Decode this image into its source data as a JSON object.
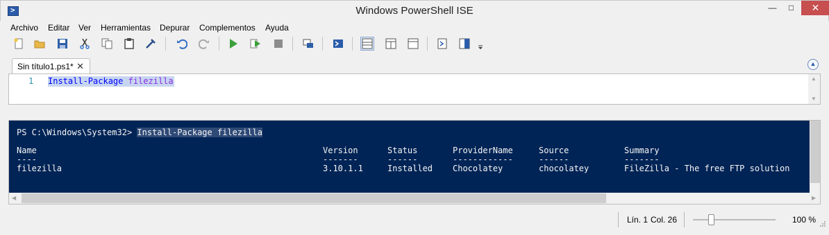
{
  "window": {
    "title": "Windows PowerShell ISE",
    "minimize": "—",
    "maximize": "□",
    "close": "✕"
  },
  "menu": [
    "Archivo",
    "Editar",
    "Ver",
    "Herramientas",
    "Depurar",
    "Complementos",
    "Ayuda"
  ],
  "toolbar": {
    "icons": [
      "new-file-icon",
      "open-folder-icon",
      "save-icon",
      "cut-icon",
      "copy-icon",
      "paste-icon",
      "clear-console-icon",
      "undo-icon",
      "redo-icon",
      "run-script-icon",
      "run-selection-icon",
      "stop-icon",
      "new-remote-tab-icon",
      "start-powershell-icon",
      "show-script-top-icon",
      "show-script-right-icon",
      "show-script-max-icon",
      "show-command-window-icon",
      "show-command-addon-icon",
      "toolbar-overflow-icon"
    ]
  },
  "tabs": [
    {
      "label": "Sin título1.ps1*",
      "close": "✕"
    }
  ],
  "editor": {
    "line_number": "1",
    "command": "Install-Package",
    "argument": "filezilla"
  },
  "console": {
    "prompt": "PS C:\\Windows\\System32> ",
    "command": "Install-Package filezilla",
    "columns": [
      "Name",
      "Version",
      "Status",
      "ProviderName",
      "Source",
      "Summary"
    ],
    "dashes": [
      "----",
      "-------",
      "------",
      "------------",
      "------",
      "-------"
    ],
    "rows": [
      [
        "filezilla",
        "3.10.1.1",
        "Installed",
        "Chocolatey",
        "chocolatey",
        "FileZilla - The free FTP solution"
      ]
    ]
  },
  "status": {
    "line": "Lín. 1",
    "column": "Col. 26",
    "zoom": "100 %",
    "zoom_level": 100
  },
  "colors": {
    "console_bg": "#012456",
    "close_button": "#c74f50",
    "selection": "#c7d6f0"
  }
}
